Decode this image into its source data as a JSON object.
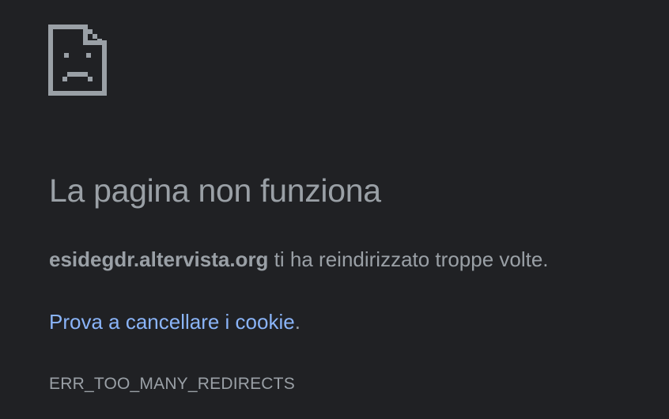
{
  "icon": "sad-page-icon",
  "colors": {
    "background": "#202124",
    "text": "#9aa0a6",
    "link": "#8ab4f8"
  },
  "error": {
    "title": "La pagina non funziona",
    "host": "esidegdr.altervista.org",
    "message_suffix": " ti ha reindirizzato troppe volte.",
    "suggestion_link": "Prova a cancellare i cookie",
    "suggestion_suffix": ".",
    "code": "ERR_TOO_MANY_REDIRECTS"
  }
}
